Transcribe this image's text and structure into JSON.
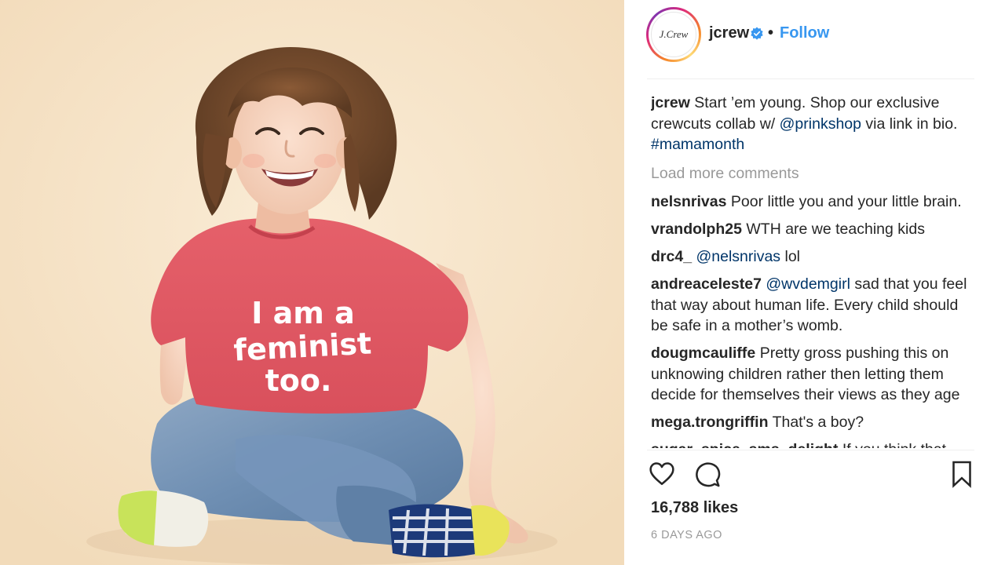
{
  "post": {
    "image": {
      "shirt_text": [
        "I am a",
        "feminist",
        "too."
      ]
    },
    "header": {
      "avatar_text": "J.Crew",
      "username": "jcrew",
      "separator": "•",
      "follow_label": "Follow",
      "verified_icon": "verified-badge-icon"
    },
    "caption": {
      "username": "jcrew",
      "text_1": "Start ’em young. Shop our exclusive crewcuts collab w/ ",
      "mention": "@prinkshop",
      "text_2": " via link in bio. ",
      "hashtag": "#mamamonth"
    },
    "load_more_label": "Load more comments",
    "comments": [
      {
        "username": "nelsnrivas",
        "text": "Poor little you and your little brain."
      },
      {
        "username": "vrandolph25",
        "text": "WTH are we teaching kids"
      },
      {
        "username": "drc4_",
        "mention": "@nelsnrivas",
        "text": " lol"
      },
      {
        "username": "andreaceleste7",
        "mention": "@wvdemgirl",
        "text": " sad that you feel that way about human life. Every child should be safe in a mother’s womb."
      },
      {
        "username": "dougmcauliffe",
        "text": "Pretty gross pushing this on unknowing children rather then letting them decide for themselves their views as they age"
      },
      {
        "username": "mega.trongriffin",
        "text": "That's a boy?"
      },
      {
        "username": "sugar_spice_sms_delight",
        "text": "If you think that"
      }
    ],
    "actions": {
      "like_icon": "heart-icon",
      "comment_icon": "comment-bubble-icon",
      "save_icon": "bookmark-icon"
    },
    "likes": "16,788 likes",
    "timestamp": "6 DAYS AGO",
    "colors": {
      "link_blue": "#3897f0",
      "mention_blue": "#003569",
      "muted_gray": "#999999",
      "text": "#262626"
    }
  }
}
